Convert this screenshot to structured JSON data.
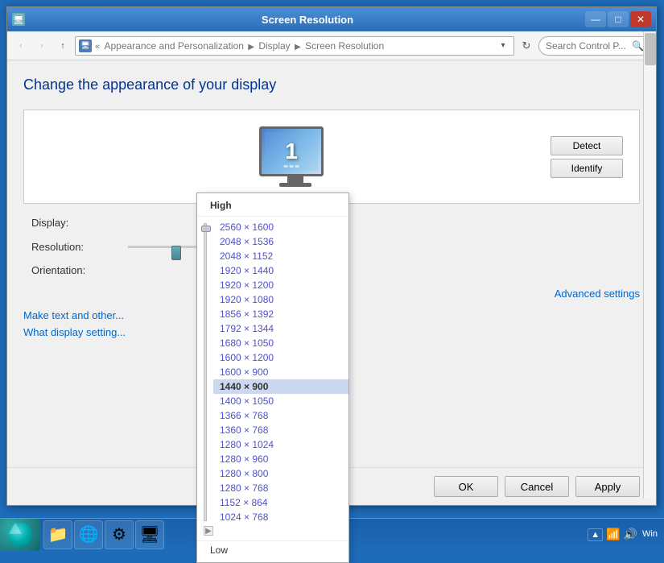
{
  "window": {
    "title": "Screen Resolution",
    "icon": "🖥"
  },
  "titlebar": {
    "title": "Screen Resolution",
    "minimize": "—",
    "maximize": "□",
    "close": "✕"
  },
  "navbar": {
    "back": "‹",
    "forward": "›",
    "up": "↑",
    "address_icon": "🖥",
    "address_path": "« Appearance and Personalization ▶ Display ▶ Screen Resolution",
    "dropdown_arrow": "▾",
    "refresh": "↻",
    "search_placeholder": "Search Control P...",
    "search_button": "🔍"
  },
  "header": {
    "page_title": "Change the appearance of your display"
  },
  "monitor": {
    "number": "1",
    "detect_btn": "Detect",
    "identify_btn": "Identify"
  },
  "settings": {
    "display_label": "Display:",
    "display_value": "",
    "resolution_label": "Resolution:",
    "resolution_value": "",
    "orientation_label": "Orientation:",
    "orientation_value": "",
    "advanced_settings": "Advanced settings"
  },
  "footer": {
    "link1": "Make text and other...",
    "link2": "What display setting..."
  },
  "buttons": {
    "ok": "OK",
    "cancel": "Cancel",
    "apply": "Apply"
  },
  "dropdown": {
    "header": "High",
    "footer": "Low",
    "resolutions": [
      {
        "label": "2560 × 1600",
        "selected": false
      },
      {
        "label": "2048 × 1536",
        "selected": false
      },
      {
        "label": "2048 × 1152",
        "selected": false
      },
      {
        "label": "1920 × 1440",
        "selected": false
      },
      {
        "label": "1920 × 1200",
        "selected": false
      },
      {
        "label": "1920 × 1080",
        "selected": false
      },
      {
        "label": "1856 × 1392",
        "selected": false
      },
      {
        "label": "1792 × 1344",
        "selected": false
      },
      {
        "label": "1680 × 1050",
        "selected": false
      },
      {
        "label": "1600 × 1200",
        "selected": false
      },
      {
        "label": "1600 × 900",
        "selected": false
      },
      {
        "label": "1440 × 900",
        "selected": true
      },
      {
        "label": "1400 × 1050",
        "selected": false
      },
      {
        "label": "1366 × 768",
        "selected": false
      },
      {
        "label": "1360 × 768",
        "selected": false
      },
      {
        "label": "1280 × 1024",
        "selected": false
      },
      {
        "label": "1280 × 960",
        "selected": false
      },
      {
        "label": "1280 × 800",
        "selected": false
      },
      {
        "label": "1280 × 768",
        "selected": false
      },
      {
        "label": "1152 × 864",
        "selected": false
      },
      {
        "label": "1024 × 768",
        "selected": false
      }
    ]
  },
  "taskbar": {
    "start_label": "",
    "apps": [
      "🌀",
      "📁",
      "🌐",
      "⚙"
    ],
    "clock": "Win",
    "tray_icons": [
      "▲",
      "🔊",
      "📶"
    ]
  }
}
